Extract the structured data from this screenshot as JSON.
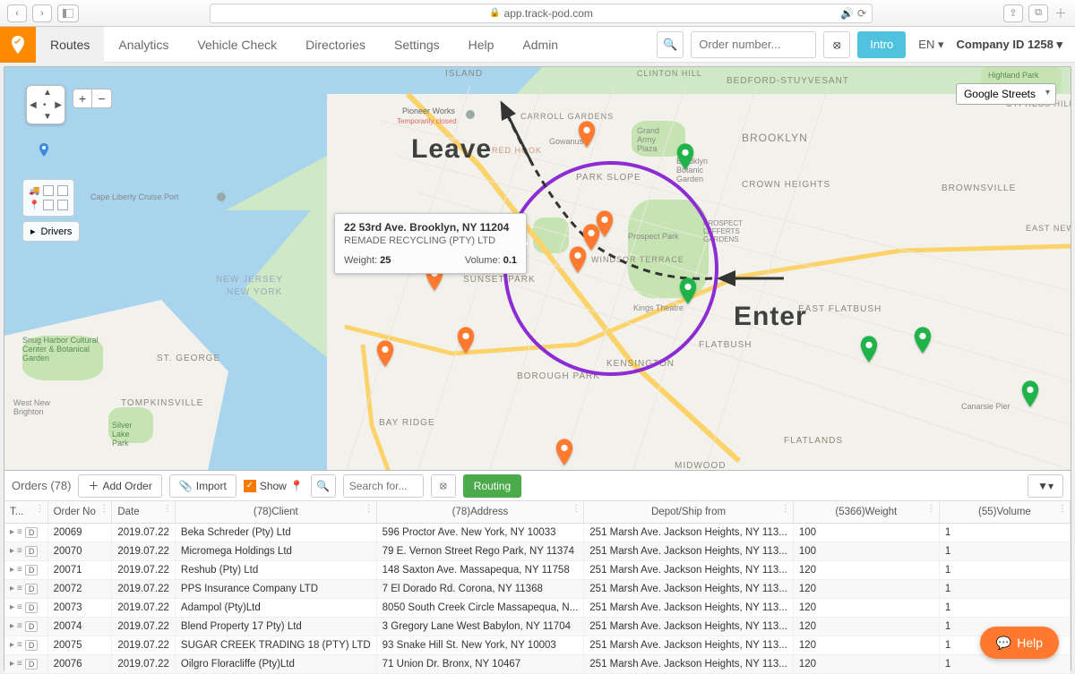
{
  "browser": {
    "url": "app.track-pod.com"
  },
  "nav": {
    "items": [
      "Routes",
      "Analytics",
      "Vehicle Check",
      "Directories",
      "Settings",
      "Help",
      "Admin"
    ],
    "active": 0,
    "search_placeholder": "Order number...",
    "intro": "Intro",
    "lang": "EN",
    "company": "Company ID 1258"
  },
  "map": {
    "layer": "Google Streets",
    "labels": {
      "bedford": "BEDFORD-STUYVESANT",
      "brooklyn": "BROOKLYN",
      "crown": "CROWN HEIGHTS",
      "brownsville": "BROWNSVILLE",
      "eastfb": "EAST FLATBUSH",
      "flatbush": "FLATBUSH",
      "flatlands": "FLATLANDS",
      "midwood": "MIDWOOD",
      "kensington": "KENSINGTON",
      "boroughpark": "BOROUGH PARK",
      "sunsetpark": "SUNSET PARK",
      "parkslope": "PARK SLOPE",
      "prospectpark": "Prospect Park",
      "windsor": "WINDSOR TERRACE",
      "gowanus": "Gowanus",
      "grandarmy": "Grand Army Plaza",
      "botanic": "Brooklyn Botanic Garden",
      "kingstheatre": "Kings Theatre",
      "bayridge": "BAY RIDGE",
      "redhook": "RED HOOK",
      "carroll": "CARROLL GARDENS",
      "island": "Island",
      "pioneer": "Pioneer Works",
      "pioneer2": "Temporarily closed",
      "nj": "NEW JERSEY",
      "ny": "NEW YORK",
      "stgeorge": "ST. GEORGE",
      "tompkins": "TOMPKINSVILLE",
      "westbrighton": "West New Brighton",
      "snug": "Snug Harbor Cultural Center & Botanical Garden",
      "silverlake": "Silver Lake Park",
      "capeliberty": "Cape Liberty Cruise Port",
      "prospectlg": "PROSPECT LEFFERTS GARDENS",
      "clintonhill": "CLINTON HILL",
      "cypress": "CYPRESS HILLS",
      "highland": "Highland Park",
      "canarsie": "Canarsie Pier",
      "eastny": "EAST NEW YORK"
    },
    "tooltip": {
      "address": "22 53rd Ave. Brooklyn, NY 11204",
      "client": "REMADE RECYCLING (PTY) LTD",
      "weight_label": "Weight:",
      "weight": "25",
      "volume_label": "Volume:",
      "volume": "0.1"
    },
    "drivers_label": "Drivers",
    "annotations": {
      "leave": "Leave",
      "enter": "Enter"
    }
  },
  "orders": {
    "title": "Orders (78)",
    "add": "Add Order",
    "import": "Import",
    "show": "Show",
    "search_placeholder": "Search for...",
    "routing": "Routing",
    "columns": {
      "t": "T...",
      "orderno": "Order No",
      "date": "Date",
      "client": "(78)Client",
      "address": "(78)Address",
      "depot": "Depot/Ship from",
      "weight": "(5366)Weight",
      "volume": "(55)Volume"
    },
    "rows": [
      {
        "no": "20069",
        "date": "2019.07.22",
        "client": "Beka Schreder (Pty) Ltd",
        "addr": "596 Proctor Ave. New York, NY 10033",
        "depot": "251 Marsh Ave. Jackson Heights, NY 113...",
        "weight": "100",
        "vol": "1"
      },
      {
        "no": "20070",
        "date": "2019.07.22",
        "client": "Micromega Holdings Ltd",
        "addr": "79 E. Vernon Street Rego Park, NY 11374",
        "depot": "251 Marsh Ave. Jackson Heights, NY 113...",
        "weight": "100",
        "vol": "1"
      },
      {
        "no": "20071",
        "date": "2019.07.22",
        "client": "Reshub (Pty) Ltd",
        "addr": "148 Saxton Ave. Massapequa, NY 11758",
        "depot": "251 Marsh Ave. Jackson Heights, NY 113...",
        "weight": "120",
        "vol": "1"
      },
      {
        "no": "20072",
        "date": "2019.07.22",
        "client": "PPS Insurance Company LTD",
        "addr": "7 El Dorado Rd. Corona, NY 11368",
        "depot": "251 Marsh Ave. Jackson Heights, NY 113...",
        "weight": "120",
        "vol": "1"
      },
      {
        "no": "20073",
        "date": "2019.07.22",
        "client": "Adampol (Pty)Ltd",
        "addr": "8050 South Creek Circle Massapequa, N...",
        "depot": "251 Marsh Ave. Jackson Heights, NY 113...",
        "weight": "120",
        "vol": "1"
      },
      {
        "no": "20074",
        "date": "2019.07.22",
        "client": "Blend Property 17 Pty) Ltd",
        "addr": "3 Gregory Lane West Babylon, NY 11704",
        "depot": "251 Marsh Ave. Jackson Heights, NY 113...",
        "weight": "120",
        "vol": "1"
      },
      {
        "no": "20075",
        "date": "2019.07.22",
        "client": "SUGAR CREEK TRADING 18 (PTY) LTD",
        "addr": "93 Snake Hill St. New York, NY 10003",
        "depot": "251 Marsh Ave. Jackson Heights, NY 113...",
        "weight": "120",
        "vol": "1"
      },
      {
        "no": "20076",
        "date": "2019.07.22",
        "client": "Oilgro Floracliffe (Pty)Ltd",
        "addr": "71 Union Dr. Bronx, NY 10467",
        "depot": "251 Marsh Ave. Jackson Heights, NY 113...",
        "weight": "120",
        "vol": "1"
      }
    ]
  },
  "help": {
    "label": "Help"
  }
}
